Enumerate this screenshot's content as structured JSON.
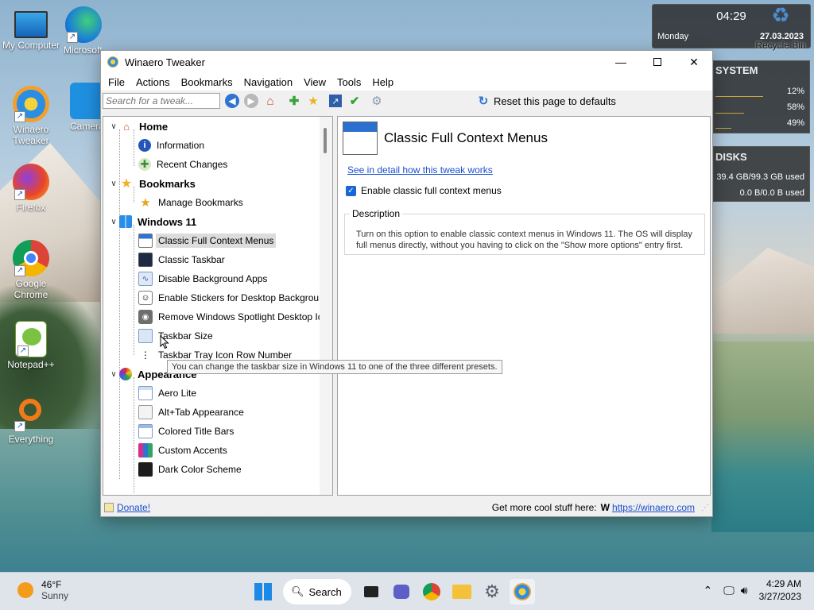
{
  "desktop": {
    "icons": [
      {
        "label": "My Computer"
      },
      {
        "label": "Microsoft Edge"
      },
      {
        "label": "Winaero Tweaker"
      },
      {
        "label": "Camera"
      },
      {
        "label": "Firefox"
      },
      {
        "label": "Google Chrome"
      },
      {
        "label": "Notepad++"
      },
      {
        "label": "Everything"
      },
      {
        "label": "Recycle Bin"
      }
    ]
  },
  "widgets": {
    "clock": {
      "time": "04:29",
      "day": "Monday",
      "date": "27.03.2023"
    },
    "system": {
      "title": "SYSTEM",
      "values": [
        "12%",
        "58%",
        "49%"
      ]
    },
    "disks": {
      "title": "DISKS",
      "used": "39.4 GB/99.3 GB used",
      "io": "0.0 B/0.0 B used"
    }
  },
  "window": {
    "title": "Winaero Tweaker",
    "menus": [
      "File",
      "Actions",
      "Bookmarks",
      "Navigation",
      "View",
      "Tools",
      "Help"
    ],
    "search_placeholder": "Search for a tweak...",
    "reset_label": "Reset this page to defaults",
    "tree": [
      {
        "label": "Home",
        "type": "cat",
        "icon": "home-icon"
      },
      {
        "label": "Information",
        "type": "item",
        "icon": "info-icon"
      },
      {
        "label": "Recent Changes",
        "type": "item",
        "icon": "recent-changes-icon"
      },
      {
        "label": "Bookmarks",
        "type": "cat",
        "icon": "star-icon"
      },
      {
        "label": "Manage Bookmarks",
        "type": "item",
        "icon": "star-icon"
      },
      {
        "label": "Windows 11",
        "type": "cat",
        "icon": "windows-logo-icon"
      },
      {
        "label": "Classic Full Context Menus",
        "type": "item",
        "icon": "context-menu-icon",
        "selected": true
      },
      {
        "label": "Classic Taskbar",
        "type": "item",
        "icon": "taskbar-icon"
      },
      {
        "label": "Disable Background Apps",
        "type": "item",
        "icon": "apps-icon"
      },
      {
        "label": "Enable Stickers for Desktop Background",
        "type": "item",
        "icon": "sticker-icon"
      },
      {
        "label": "Remove Windows Spotlight Desktop Icon",
        "type": "item",
        "icon": "camera-icon"
      },
      {
        "label": "Taskbar Size",
        "type": "item",
        "icon": "taskbar-size-icon"
      },
      {
        "label": "Taskbar Tray Icon Row Number",
        "type": "item",
        "icon": "tray-icon"
      },
      {
        "label": "Appearance",
        "type": "cat",
        "icon": "palette-icon"
      },
      {
        "label": "Aero Lite",
        "type": "item",
        "icon": "window-icon"
      },
      {
        "label": "Alt+Tab Appearance",
        "type": "item",
        "icon": "alt-tab-icon"
      },
      {
        "label": "Colored Title Bars",
        "type": "item",
        "icon": "window-icon"
      },
      {
        "label": "Custom Accents",
        "type": "item",
        "icon": "accents-icon"
      },
      {
        "label": "Dark Color Scheme",
        "type": "item",
        "icon": "dark-scheme-icon"
      }
    ],
    "tooltip": "You can change the taskbar size in Windows 11 to one of the three different presets.",
    "content": {
      "title": "Classic Full Context Menus",
      "detail_link": "See in detail how this tweak works",
      "checkbox_label": "Enable classic full context menus",
      "checkbox_checked": true,
      "description_legend": "Description",
      "description": "Turn on this option to enable classic context menus in Windows 11. The OS will display full menus directly, without you having to click on the \"Show more options\" entry first."
    },
    "status": {
      "donate": "Donate!",
      "more": "Get more cool stuff here:",
      "site_logo": "W",
      "url": "https://winaero.com"
    }
  },
  "taskbar": {
    "weather_temp": "46°F",
    "weather_desc": "Sunny",
    "search_label": "Search",
    "time": "4:29 AM",
    "date": "3/27/2023"
  }
}
